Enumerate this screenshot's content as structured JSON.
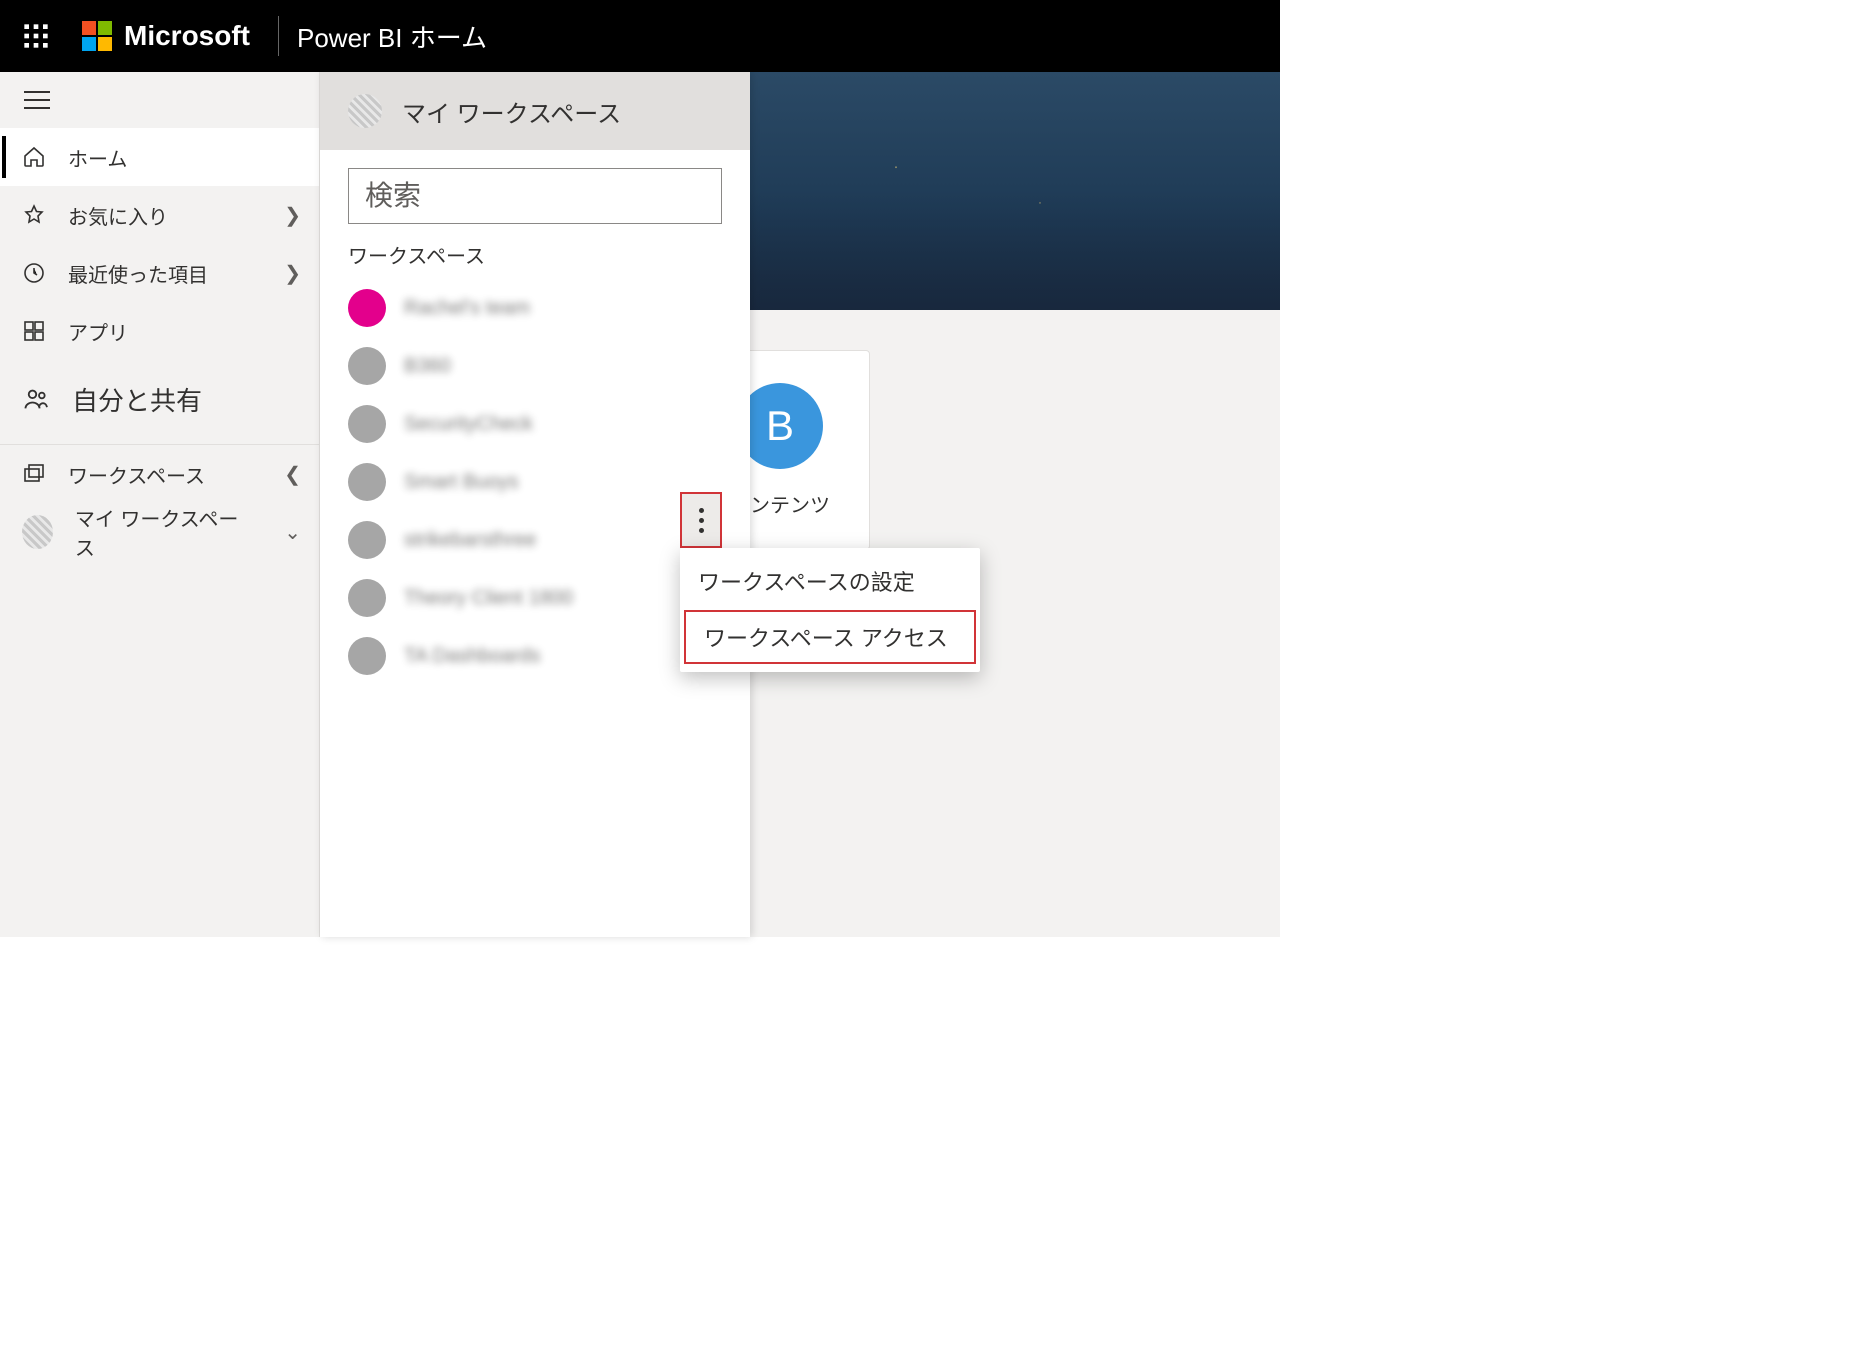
{
  "topbar": {
    "brand": "Microsoft",
    "app": "Power BI",
    "page": "ホーム"
  },
  "nav": {
    "home": "ホーム",
    "favorites": "お気に入り",
    "recent": "最近使った項目",
    "apps": "アプリ",
    "shared": "自分と共有",
    "workspaces": "ワークスペース",
    "my_workspace": "マイ ワークスペース"
  },
  "wsPanel": {
    "title": "マイ ワークスペース",
    "search_placeholder": "検索",
    "section": "ワークスペース",
    "items": [
      {
        "name": "Rachel's team"
      },
      {
        "name": "B360"
      },
      {
        "name": "SecurityCheck"
      },
      {
        "name": "Smart Buoys"
      },
      {
        "name": "strikebarsthree"
      },
      {
        "name": "Theory Client 1800"
      },
      {
        "name": "TA Dashboards"
      }
    ]
  },
  "cards": [
    {
      "letter": "B",
      "caption": "コンテンツ"
    }
  ],
  "ctx": {
    "settings": "ワークスペースの設定",
    "access": "ワークスペース アクセス"
  }
}
